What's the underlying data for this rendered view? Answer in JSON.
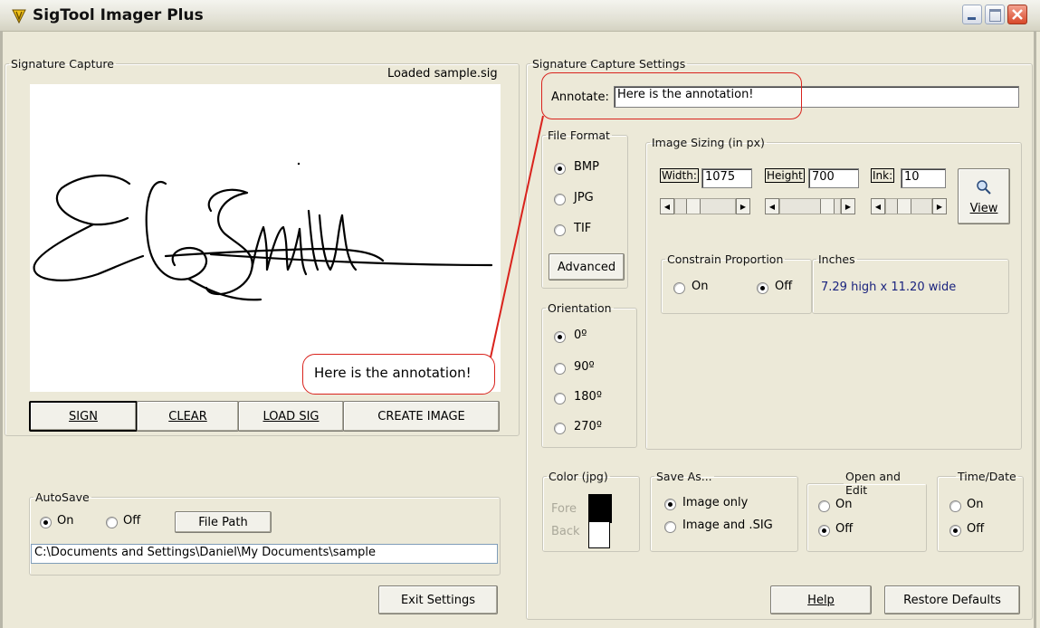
{
  "window": {
    "title": "SigTool Imager Plus"
  },
  "capture": {
    "legend": "Signature Capture",
    "status": "Loaded sample.sig",
    "signature_annotation": "Here is the annotation!",
    "buttons": {
      "sign": "SIGN",
      "clear": "CLEAR",
      "load": "LOAD SIG",
      "create": "CREATE IMAGE"
    }
  },
  "autosave": {
    "legend": "AutoSave",
    "on_label": "On",
    "off_label": "Off",
    "selected": "On",
    "file_path_button": "File Path",
    "path": "C:\\Documents and Settings\\Daniel\\My Documents\\sample"
  },
  "exit_button": "Exit Settings",
  "settings": {
    "legend": "Signature Capture Settings",
    "annotate_label": "Annotate:",
    "annotate_value": "Here is the annotation!",
    "file_format": {
      "legend": "File Format",
      "options": [
        "BMP",
        "JPG",
        "TIF"
      ],
      "selected": "BMP",
      "advanced_button": "Advanced"
    },
    "orientation": {
      "legend": "Orientation",
      "options": [
        "0º",
        "90º",
        "180º",
        "270º"
      ],
      "selected": "0º"
    },
    "image_sizing": {
      "legend": "Image Sizing (in px)",
      "width_label": "Width:",
      "width_value": "1075",
      "height_label": "Height",
      "height_value": "700",
      "ink_label": "Ink:",
      "ink_value": "10",
      "view_button": "View"
    },
    "constrain": {
      "legend": "Constrain Proportion",
      "on_label": "On",
      "off_label": "Off",
      "selected": "Off"
    },
    "inches": {
      "legend": "Inches",
      "value": "7.29 high x 11.20 wide"
    },
    "color": {
      "legend": "Color (jpg)",
      "fore": "Fore",
      "back": "Back",
      "fore_color": "#000000",
      "back_color": "#ffffff"
    },
    "save_as": {
      "legend": "Save As...",
      "options": [
        "Image only",
        "Image and .SIG"
      ],
      "selected": "Image only"
    },
    "open_edit": {
      "legend": "Open and Edit",
      "on_label": "On",
      "off_label": "Off",
      "selected": "Off"
    },
    "time_date": {
      "legend": "Time/Date",
      "on_label": "On",
      "off_label": "Off",
      "selected": "Off"
    }
  },
  "help_button": "Help",
  "restore_button": "Restore Defaults",
  "colors": {
    "callout": "#d9231d",
    "inches_text": "#1a237e"
  }
}
